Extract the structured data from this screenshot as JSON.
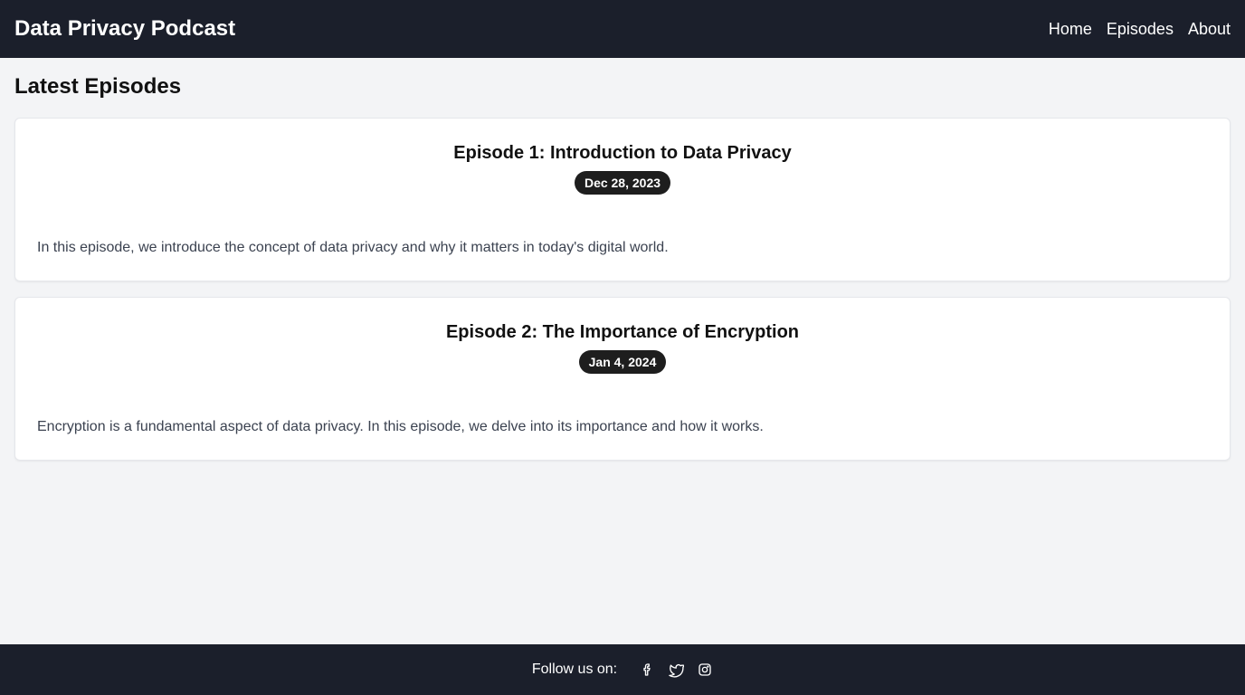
{
  "header": {
    "brand": "Data Privacy Podcast",
    "nav": [
      {
        "label": "Home"
      },
      {
        "label": "Episodes"
      },
      {
        "label": "About"
      }
    ]
  },
  "main": {
    "title": "Latest Episodes",
    "episodes": [
      {
        "title": "Episode 1: Introduction to Data Privacy",
        "date": "Dec 28, 2023",
        "description": "In this episode, we introduce the concept of data privacy and why it matters in today's digital world."
      },
      {
        "title": "Episode 2: The Importance of Encryption",
        "date": "Jan 4, 2024",
        "description": "Encryption is a fundamental aspect of data privacy. In this episode, we delve into its importance and how it works."
      }
    ]
  },
  "footer": {
    "follow_label": "Follow us on:",
    "social_icons": [
      "facebook-icon",
      "twitter-icon",
      "instagram-icon"
    ]
  },
  "colors": {
    "header_bg": "#1b1f2b",
    "page_bg": "#f3f4f6",
    "badge_bg": "#1e1e1e"
  }
}
